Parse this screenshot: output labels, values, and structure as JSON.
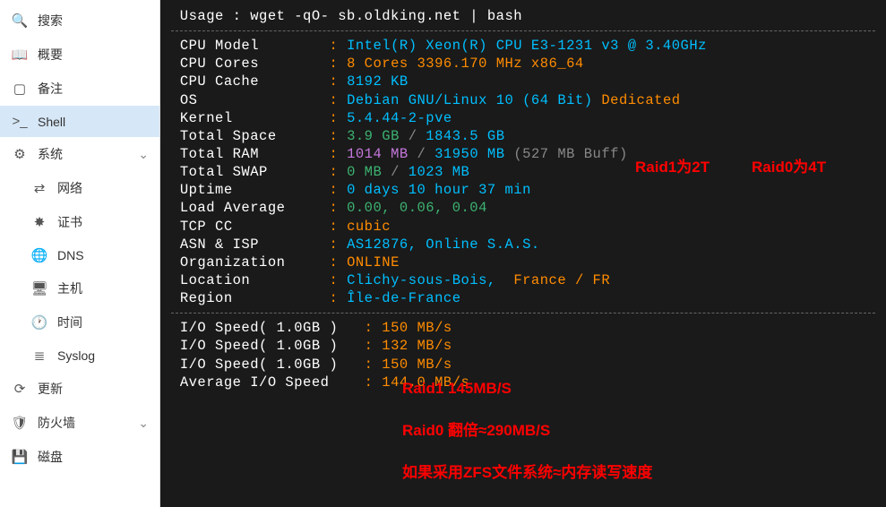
{
  "sidebar": {
    "items": [
      {
        "icon": "🔍",
        "label": "搜索"
      },
      {
        "icon": "📖",
        "label": "概要"
      },
      {
        "icon": "▢",
        "label": "备注"
      },
      {
        "icon": ">_",
        "label": "Shell",
        "active": true
      },
      {
        "icon": "⚙",
        "label": "系统",
        "expand": true
      },
      {
        "icon": "⇄",
        "label": "网络",
        "sub": true
      },
      {
        "icon": "✸",
        "label": "证书",
        "sub": true
      },
      {
        "icon": "🌐",
        "label": "DNS",
        "sub": true
      },
      {
        "icon": "🖥",
        "label": "主机",
        "sub": true
      },
      {
        "icon": "🕐",
        "label": "时间",
        "sub": true
      },
      {
        "icon": "≣",
        "label": "Syslog",
        "sub": true
      },
      {
        "icon": "⟳",
        "label": "更新"
      },
      {
        "icon": "🛡",
        "label": "防火墙",
        "expand": true
      },
      {
        "icon": "💾",
        "label": "磁盘"
      }
    ]
  },
  "terminal": {
    "usage": " Usage : wget -qO- sb.oldking.net | bash",
    "info": [
      {
        "label": "CPU Model",
        "value": "Intel(R) Xeon(R) CPU E3-1231 v3 @ 3.40GHz",
        "cls": "val-cyan"
      },
      {
        "label": "CPU Cores",
        "value": "8 Cores 3396.170 MHz x86_64",
        "cls": "val-yellow"
      },
      {
        "label": "CPU Cache",
        "value": "8192 KB",
        "cls": "val-cyan"
      },
      {
        "label": "OS",
        "value": "Debian GNU/Linux 10 (64 Bit)",
        "cls": "val-cyan",
        "suffix": "Dedicated",
        "scls": "val-yellow"
      },
      {
        "label": "Kernel",
        "value": "5.4.44-2-pve",
        "cls": "val-cyan"
      },
      {
        "label": "Total Space",
        "value": "3.9 GB",
        "sep": " / ",
        "value2": "1843.5 GB",
        "cls": "val-green",
        "cls2": "val-cyan"
      },
      {
        "label": "Total RAM",
        "value": "1014 MB",
        "sep": " / ",
        "value2": "31950 MB",
        "cls": "val-purple",
        "cls2": "val-cyan",
        "suffix": "(527 MB Buff)",
        "scls": "val-gray"
      },
      {
        "label": "Total SWAP",
        "value": "0 MB",
        "sep": " / ",
        "value2": "1023 MB",
        "cls": "val-green",
        "cls2": "val-cyan"
      },
      {
        "label": "Uptime",
        "value": "0 days 10 hour 37 min",
        "cls": "val-cyan"
      },
      {
        "label": "Load Average",
        "value": "0.00, 0.06, 0.04",
        "cls": "val-green"
      },
      {
        "label": "TCP CC",
        "value": "cubic",
        "cls": "val-yellow"
      },
      {
        "label": "ASN & ISP",
        "value": "AS12876, Online S.A.S.",
        "cls": "val-cyan"
      },
      {
        "label": "Organization",
        "value": "ONLINE",
        "cls": "val-yellow"
      },
      {
        "label": "Location",
        "value": "Clichy-sous-Bois, ",
        "cls": "val-cyan",
        "suffix": "France / FR",
        "scls": "val-yellow"
      },
      {
        "label": "Region",
        "value": "Île-de-France",
        "cls": "val-cyan"
      }
    ],
    "io": [
      {
        "label": "I/O Speed( 1.0GB )",
        "value": "150 MB/s",
        "cls": "val-yellow"
      },
      {
        "label": "I/O Speed( 1.0GB )",
        "value": "132 MB/s",
        "cls": "val-yellow"
      },
      {
        "label": "I/O Speed( 1.0GB )",
        "value": "150 MB/s",
        "cls": "val-yellow"
      },
      {
        "label": "Average I/O Speed",
        "value": "144.0 MB/s",
        "cls": "val-yellow"
      }
    ]
  },
  "annotations": {
    "a1": "Raid1为2T",
    "a2": "Raid0为4T",
    "a3": "Raid1 145MB/S",
    "a4": "Raid0 翻倍≈290MB/S",
    "a5": "如果采用ZFS文件系统≈内存读写速度"
  }
}
